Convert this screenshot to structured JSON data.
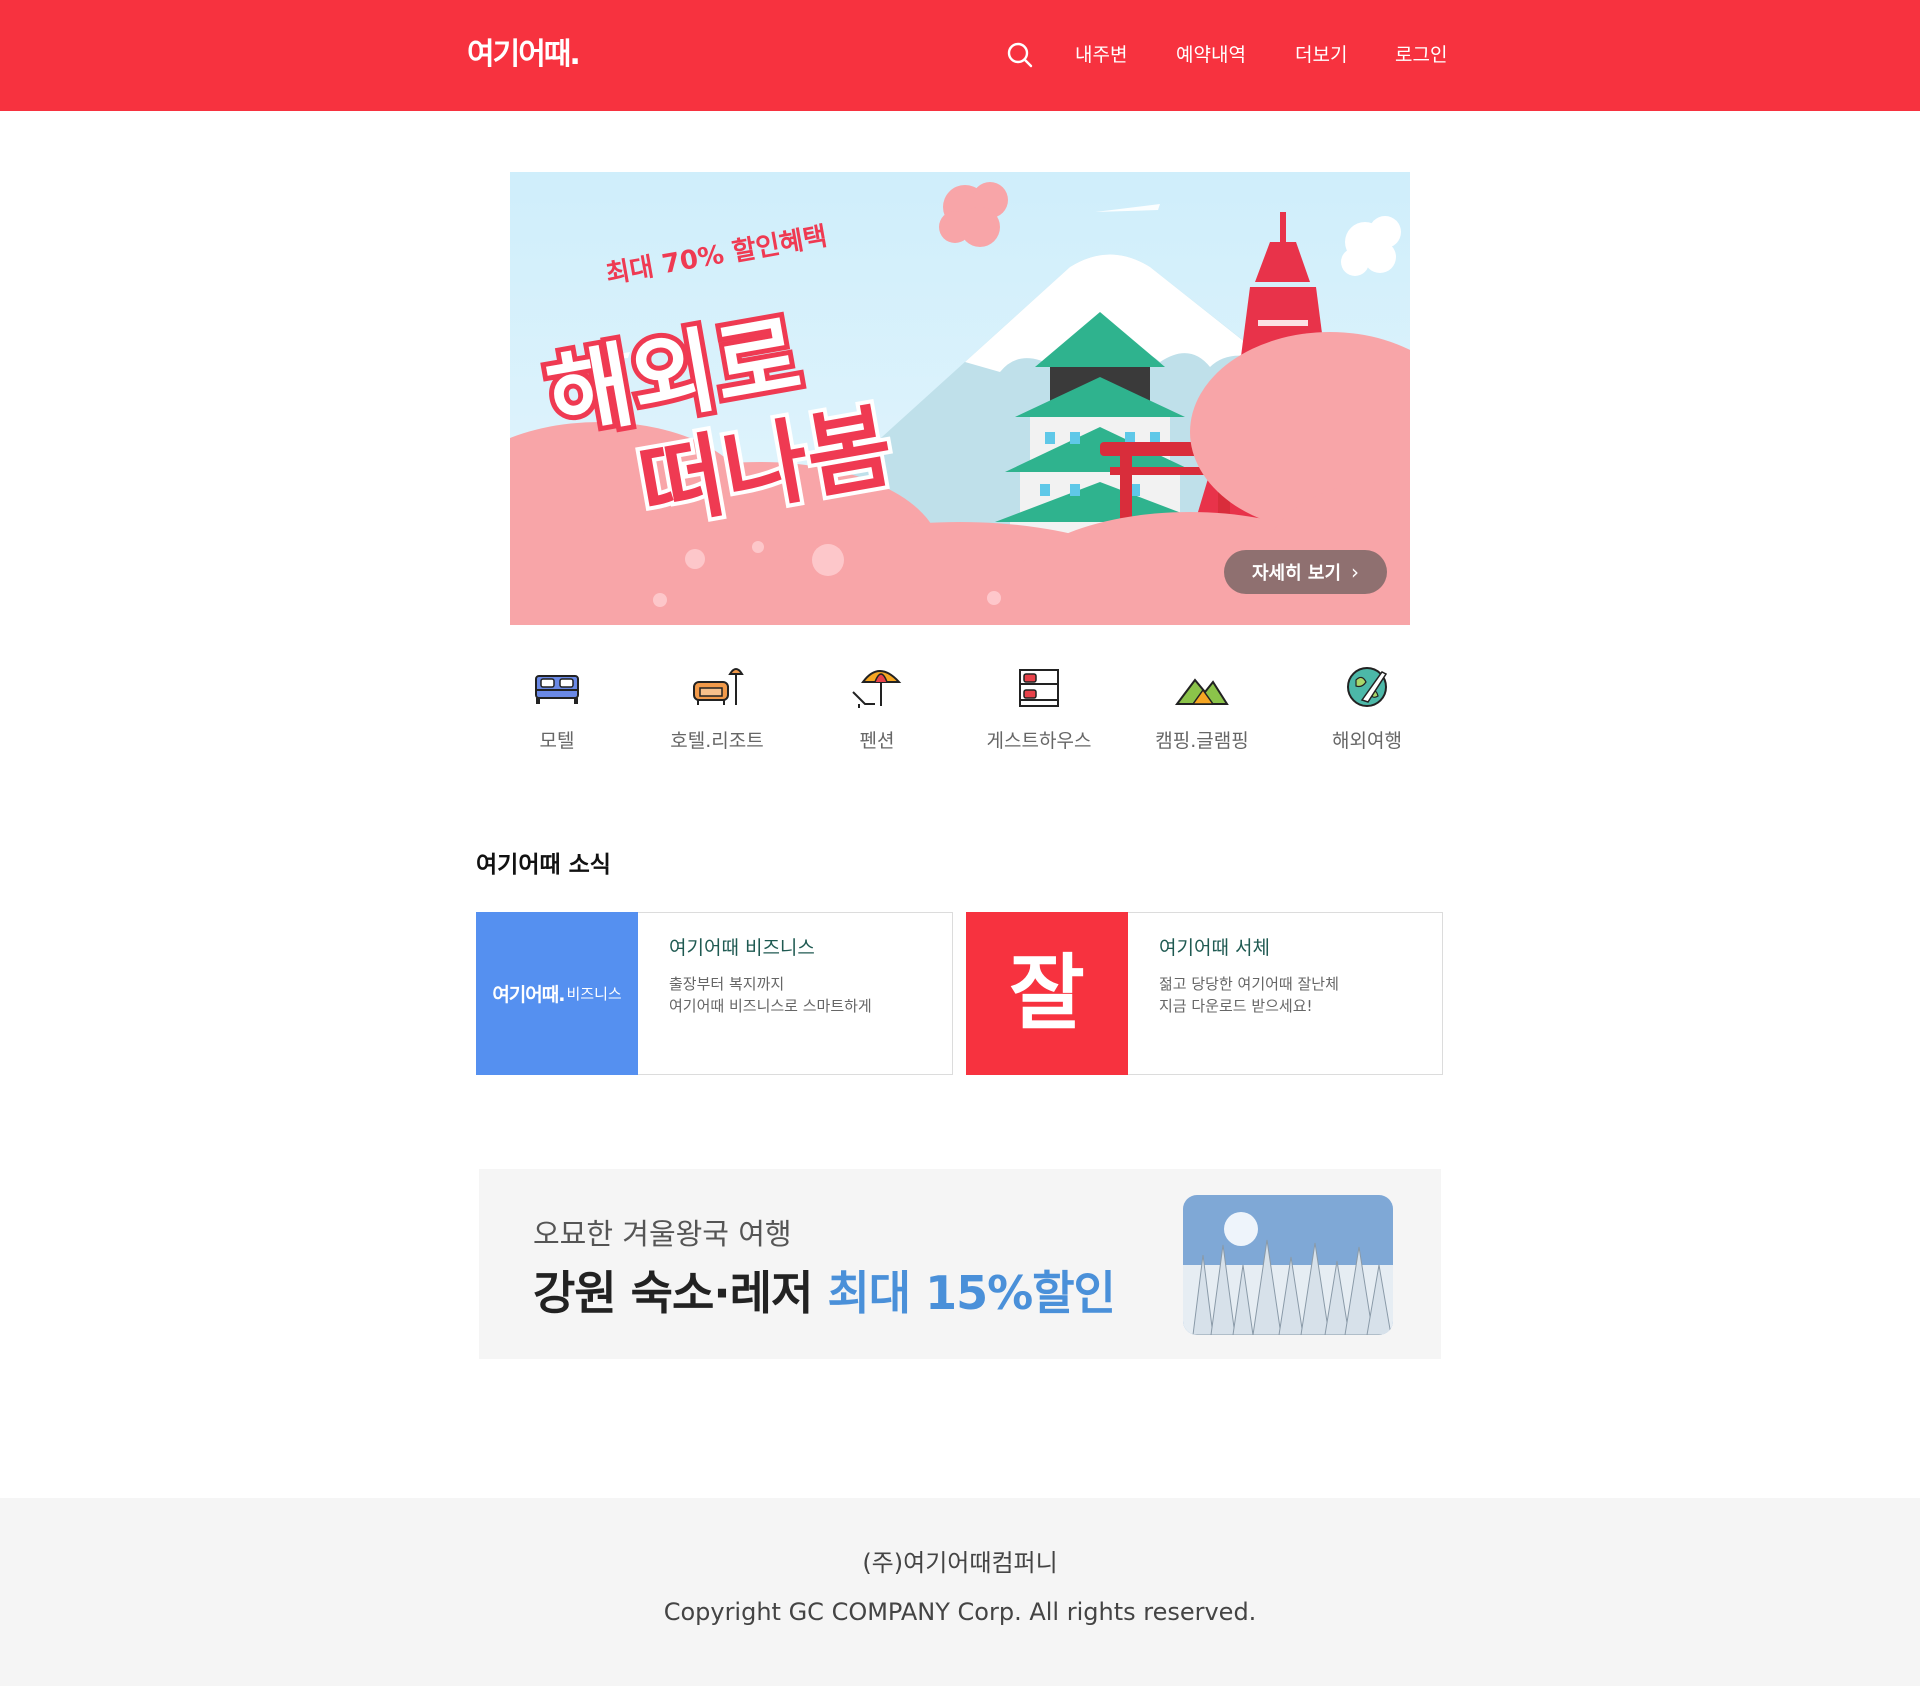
{
  "header": {
    "logo": "여기어때.",
    "search_icon": "search-icon",
    "nav": [
      "내주변",
      "예약내역",
      "더보기",
      "로그인"
    ]
  },
  "hero": {
    "subtitle": "최대 70% 할인혜택",
    "title_line1": "해외로",
    "title_line2": "떠나봄",
    "button_label": "자세히 보기",
    "button_icon": "chevron-right-icon"
  },
  "categories": [
    {
      "label": "모텔",
      "icon": "bed-icon"
    },
    {
      "label": "호텔.리조트",
      "icon": "sofa-lamp-icon"
    },
    {
      "label": "펜션",
      "icon": "beach-umbrella-icon"
    },
    {
      "label": "게스트하우스",
      "icon": "bunk-bed-icon"
    },
    {
      "label": "캠핑.글램핑",
      "icon": "tent-mountain-icon"
    },
    {
      "label": "해외여행",
      "icon": "globe-plane-icon"
    }
  ],
  "news": {
    "title": "여기어때 소식",
    "cards": [
      {
        "thumb_logo": "여기어때.",
        "thumb_suffix": "비즈니스",
        "thumb_color": "#5590f0",
        "name": "여기어때 비즈니스",
        "desc_line1": "출장부터 복지까지",
        "desc_line2": "여기어때 비즈니스로 스마트하게"
      },
      {
        "thumb_text": "잘",
        "thumb_color": "#f7323f",
        "name": "여기어때 서체",
        "desc_line1": "젊고 당당한 여기어때 잘난체",
        "desc_line2": "지금 다운로드 받으세요!"
      }
    ]
  },
  "promo": {
    "subtitle": "오묘한 겨울왕국 여행",
    "main_text": "강원 숙소·레저 ",
    "highlight": "최대 15%할인"
  },
  "footer": {
    "company": "(주)여기어때컴퍼니",
    "copyright": "Copyright GC COMPANY Corp. All rights reserved."
  },
  "colors": {
    "brand": "#f7323f",
    "business_blue": "#5590f0",
    "promo_highlight": "#4a90d9"
  }
}
